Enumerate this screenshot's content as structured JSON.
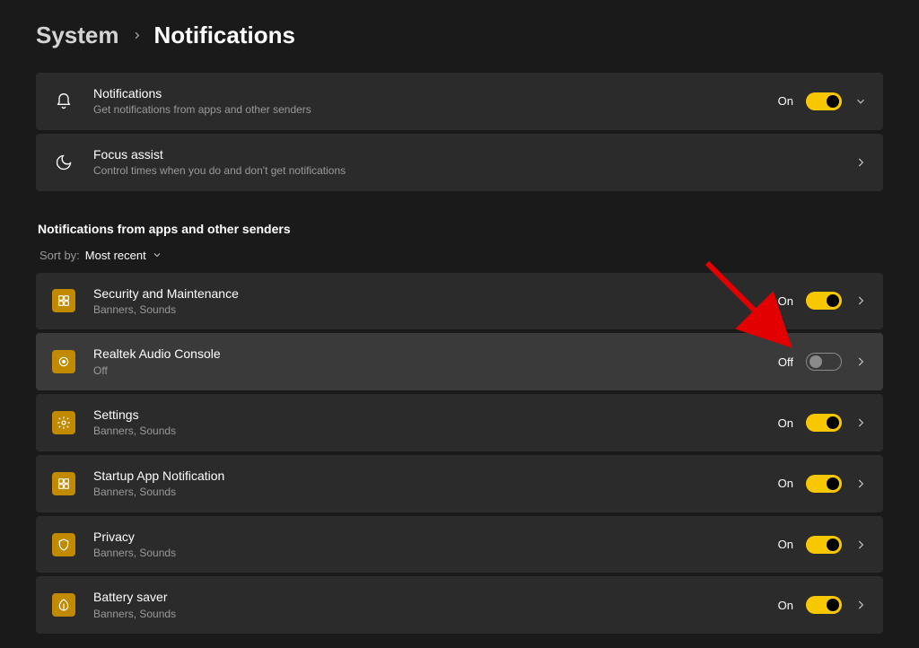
{
  "breadcrumb": {
    "parent": "System",
    "current": "Notifications"
  },
  "top_cards": [
    {
      "icon": "bell",
      "title": "Notifications",
      "subtitle": "Get notifications from apps and other senders",
      "state_label": "On",
      "toggle": "on",
      "chevron": "down"
    },
    {
      "icon": "moon",
      "title": "Focus assist",
      "subtitle": "Control times when you do and don't get notifications",
      "state_label": "",
      "toggle": "",
      "chevron": "right"
    }
  ],
  "section_header": "Notifications from apps and other senders",
  "sort": {
    "label": "Sort by:",
    "value": "Most recent"
  },
  "apps": [
    {
      "icon_bg": "#c28a00",
      "glyph": "grid",
      "title": "Security and Maintenance",
      "subtitle": "Banners, Sounds",
      "state_label": "On",
      "toggle": "on",
      "hovered": false
    },
    {
      "icon_bg": "#c28a00",
      "glyph": "circle",
      "title": "Realtek Audio Console",
      "subtitle": "Off",
      "state_label": "Off",
      "toggle": "off",
      "hovered": true
    },
    {
      "icon_bg": "#c28a00",
      "glyph": "gear",
      "title": "Settings",
      "subtitle": "Banners, Sounds",
      "state_label": "On",
      "toggle": "on",
      "hovered": false
    },
    {
      "icon_bg": "#c28a00",
      "glyph": "grid",
      "title": "Startup App Notification",
      "subtitle": "Banners, Sounds",
      "state_label": "On",
      "toggle": "on",
      "hovered": false
    },
    {
      "icon_bg": "#c28a00",
      "glyph": "shield",
      "title": "Privacy",
      "subtitle": "Banners, Sounds",
      "state_label": "On",
      "toggle": "on",
      "hovered": false
    },
    {
      "icon_bg": "#c28a00",
      "glyph": "leaf",
      "title": "Battery saver",
      "subtitle": "Banners, Sounds",
      "state_label": "On",
      "toggle": "on",
      "hovered": false
    }
  ],
  "colors": {
    "accent": "#f7c700",
    "card_bg": "#2b2b2b",
    "card_bg_hover": "#3a3a3a",
    "page_bg": "#1a1a1a"
  }
}
